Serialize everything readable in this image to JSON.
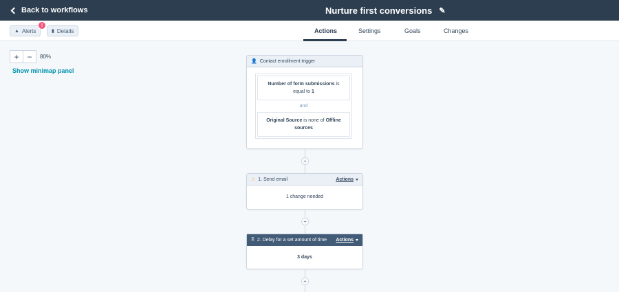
{
  "topbar": {
    "back_label": "Back to workflows",
    "title": "Nurture first conversions"
  },
  "toolbar": {
    "alerts_label": "Alerts",
    "alerts_badge": "!",
    "details_label": "Details"
  },
  "tabs": [
    {
      "label": "Actions",
      "active": true
    },
    {
      "label": "Settings",
      "active": false
    },
    {
      "label": "Goals",
      "active": false
    },
    {
      "label": "Changes",
      "active": false
    }
  ],
  "canvas": {
    "zoom_in": "+",
    "zoom_out": "−",
    "zoom_level": "80%",
    "minimap_label": "Show minimap panel"
  },
  "trigger": {
    "header": "Contact enrollment trigger",
    "filter1": {
      "field": "Number of form submissions",
      "op": " is equal to ",
      "value": "1"
    },
    "joiner": "and",
    "filter2": {
      "field": "Original Source",
      "op": " is none of ",
      "value": "Offline sources"
    }
  },
  "steps": [
    {
      "header": "1. Send email",
      "actions_label": "Actions",
      "body": "1 change needed",
      "icon": "warning-icon"
    },
    {
      "header": "2. Delay for a set amount of time",
      "actions_label": "Actions",
      "body": "3 days",
      "icon": "hourglass-icon"
    }
  ],
  "colors": {
    "topbar": "#2d3e50",
    "link": "#0091ae",
    "badge": "#f2547d",
    "warning": "#f5c26b"
  }
}
